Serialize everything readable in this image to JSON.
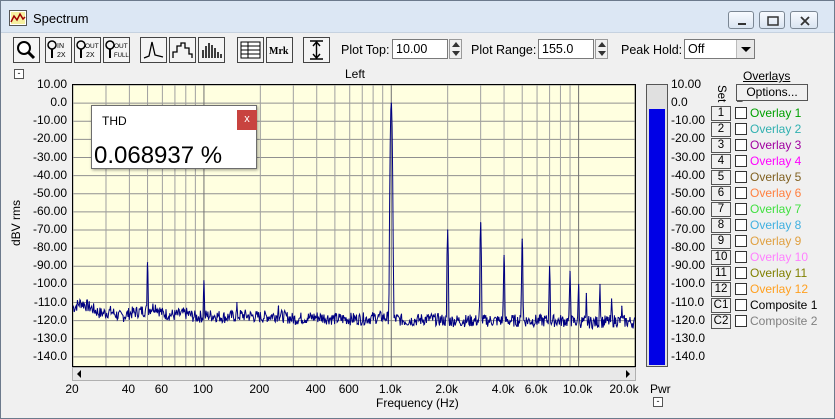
{
  "window": {
    "title": "Spectrum"
  },
  "toolbar": {
    "plot_top_label": "Plot Top:",
    "plot_top_value": "10.00",
    "plot_range_label": "Plot Range:",
    "plot_range_value": "155.0",
    "peak_hold_label": "Peak Hold:",
    "peak_hold_value": "Off",
    "zoom_in_label": "IN 2X",
    "zoom_out_label": "OUT 2X",
    "zoom_full_label": "OUT FULL",
    "marker_label": "Mrk"
  },
  "thd": {
    "title": "THD",
    "close": "x",
    "value": "0.068937 %"
  },
  "meter": {
    "label": "Pwr",
    "level_dbv": -3,
    "ticks": [
      "10.00",
      "0.0",
      "-10.00",
      "-20.00",
      "-30.00",
      "-40.00",
      "-50.00",
      "-60.00",
      "-70.00",
      "-80.00",
      "-90.00",
      "-100.0",
      "-110.0",
      "-120.0",
      "-130.0",
      "-140.0"
    ]
  },
  "overlays": {
    "title": "Overlays",
    "options_label": "Options...",
    "set_header": "Set",
    "on_header": "On",
    "items": [
      {
        "set": "1",
        "name": "Overlay 1",
        "color": "#00a000"
      },
      {
        "set": "2",
        "name": "Overlay 2",
        "color": "#30b0b0"
      },
      {
        "set": "3",
        "name": "Overlay 3",
        "color": "#a000a0"
      },
      {
        "set": "4",
        "name": "Overlay 4",
        "color": "#ff00ff"
      },
      {
        "set": "5",
        "name": "Overlay 5",
        "color": "#806020"
      },
      {
        "set": "6",
        "name": "Overlay 6",
        "color": "#ff8040"
      },
      {
        "set": "7",
        "name": "Overlay 7",
        "color": "#40e040"
      },
      {
        "set": "8",
        "name": "Overlay 8",
        "color": "#40b0e0"
      },
      {
        "set": "9",
        "name": "Overlay 9",
        "color": "#e0a040"
      },
      {
        "set": "10",
        "name": "Overlay 10",
        "color": "#ff80ff"
      },
      {
        "set": "11",
        "name": "Overlay 11",
        "color": "#808000"
      },
      {
        "set": "12",
        "name": "Overlay 12",
        "color": "#ffa020"
      },
      {
        "set": "C1",
        "name": "Composite 1",
        "color": "#000000"
      },
      {
        "set": "C2",
        "name": "Composite 2",
        "color": "#808080"
      }
    ]
  },
  "chart_data": {
    "type": "line",
    "title": "Left",
    "xlabel": "Frequency (Hz)",
    "ylabel": "dBV rms",
    "x_scale": "log",
    "xlim": [
      20,
      20000
    ],
    "ylim": [
      -145,
      10
    ],
    "grid": true,
    "color": "#000080",
    "y_ticks": [
      "10.00",
      "0.0",
      "-10.00",
      "-20.00",
      "-30.00",
      "-40.00",
      "-50.00",
      "-60.00",
      "-70.00",
      "-80.00",
      "-90.00",
      "-100.0",
      "-110.0",
      "-120.0",
      "-130.0",
      "-140.0"
    ],
    "x_ticks": [
      {
        "v": 20,
        "label": "20"
      },
      {
        "v": 40,
        "label": "40"
      },
      {
        "v": 60,
        "label": "60"
      },
      {
        "v": 100,
        "label": "100"
      },
      {
        "v": 200,
        "label": "200"
      },
      {
        "v": 400,
        "label": "400"
      },
      {
        "v": 600,
        "label": "600"
      },
      {
        "v": 1000,
        "label": "1.0k"
      },
      {
        "v": 2000,
        "label": "2.0k"
      },
      {
        "v": 4000,
        "label": "4.0k"
      },
      {
        "v": 6000,
        "label": "6.0k"
      },
      {
        "v": 10000,
        "label": "10.0k"
      },
      {
        "v": 20000,
        "label": "20.0k"
      }
    ],
    "noise_floor": [
      [
        20,
        -113
      ],
      [
        22,
        -110
      ],
      [
        25,
        -113
      ],
      [
        28,
        -116
      ],
      [
        32,
        -115
      ],
      [
        36,
        -118
      ],
      [
        40,
        -116
      ],
      [
        45,
        -115
      ],
      [
        50,
        -114
      ],
      [
        55,
        -112
      ],
      [
        60,
        -116
      ],
      [
        70,
        -117
      ],
      [
        80,
        -116
      ],
      [
        90,
        -118
      ],
      [
        110,
        -117
      ],
      [
        130,
        -118
      ],
      [
        160,
        -117
      ],
      [
        200,
        -118
      ],
      [
        250,
        -117
      ],
      [
        300,
        -119
      ],
      [
        400,
        -118
      ],
      [
        500,
        -119
      ],
      [
        700,
        -119
      ],
      [
        900,
        -118
      ],
      [
        1200,
        -120
      ],
      [
        1600,
        -119
      ],
      [
        2000,
        -120
      ],
      [
        3000,
        -120
      ],
      [
        5000,
        -120
      ],
      [
        8000,
        -120
      ],
      [
        12000,
        -121
      ],
      [
        16000,
        -120
      ],
      [
        20000,
        -121
      ]
    ],
    "peaks": [
      {
        "x": 50,
        "y": -88
      },
      {
        "x": 100,
        "y": -98
      },
      {
        "x": 150,
        "y": -110
      },
      {
        "x": 250,
        "y": -112
      },
      {
        "x": 1000,
        "y": 0
      },
      {
        "x": 2000,
        "y": -70
      },
      {
        "x": 3000,
        "y": -66
      },
      {
        "x": 4000,
        "y": -84
      },
      {
        "x": 5000,
        "y": -75
      },
      {
        "x": 7000,
        "y": -90
      },
      {
        "x": 9000,
        "y": -93
      },
      {
        "x": 10000,
        "y": -100
      },
      {
        "x": 11000,
        "y": -105
      },
      {
        "x": 13000,
        "y": -100
      },
      {
        "x": 15000,
        "y": -108
      },
      {
        "x": 17000,
        "y": -112
      }
    ]
  }
}
